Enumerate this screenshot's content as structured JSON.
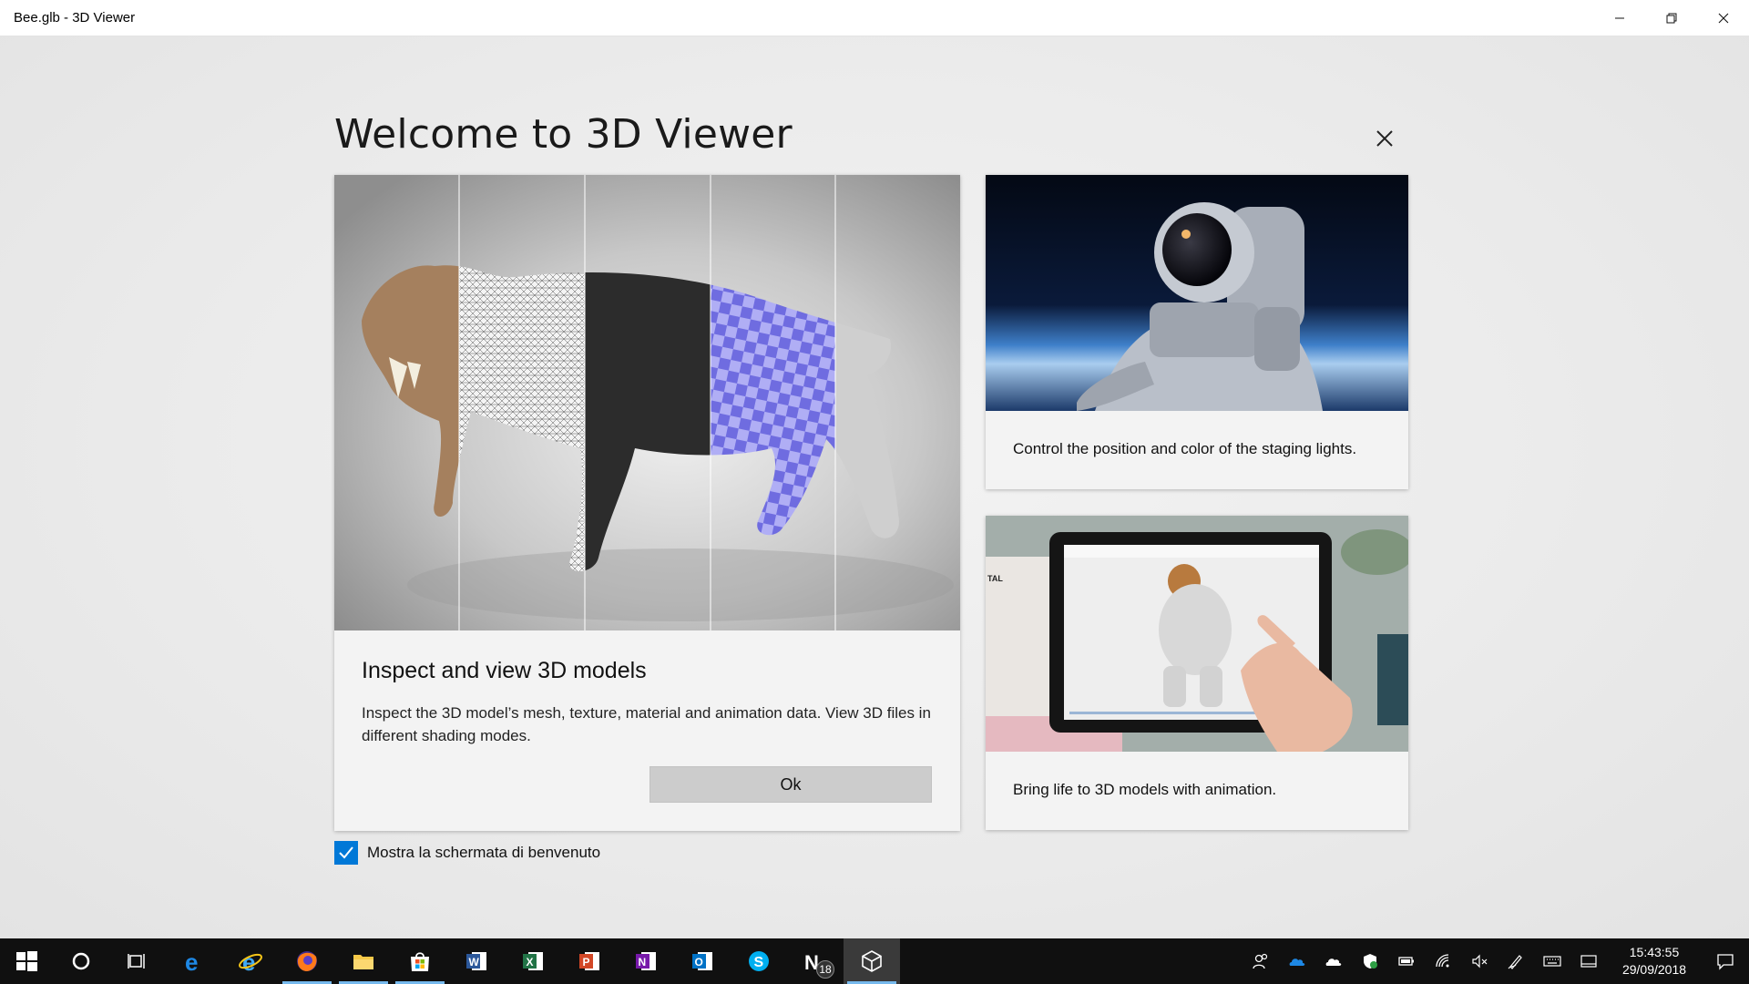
{
  "window": {
    "title": "Bee.glb - 3D Viewer",
    "controls": [
      "minimize",
      "restore",
      "close"
    ]
  },
  "welcome": {
    "title": "Welcome to 3D Viewer",
    "main_card": {
      "heading": "Inspect and view 3D models",
      "description": "Inspect the 3D model’s mesh, texture, material and animation data. View 3D files in different shading modes.",
      "ok_label": "Ok"
    },
    "side_cards": [
      {
        "caption": "Control the position and color of the staging lights."
      },
      {
        "caption": "Bring life to 3D models with animation."
      }
    ],
    "show_welcome": {
      "label": "Mostra la schermata di benvenuto",
      "checked": true
    }
  },
  "taskbar": {
    "apps": [
      {
        "icon": "start-icon"
      },
      {
        "icon": "cortana-icon"
      },
      {
        "icon": "task-view-icon"
      },
      {
        "icon": "edge-icon"
      },
      {
        "icon": "internet-explorer-icon"
      },
      {
        "icon": "firefox-icon",
        "running": true
      },
      {
        "icon": "file-explorer-icon",
        "running": true
      },
      {
        "icon": "store-icon",
        "running": true
      },
      {
        "icon": "word-icon"
      },
      {
        "icon": "excel-icon"
      },
      {
        "icon": "powerpoint-icon"
      },
      {
        "icon": "onenote-icon"
      },
      {
        "icon": "outlook-icon"
      },
      {
        "icon": "skype-icon"
      },
      {
        "icon": "nextcloud-icon",
        "badge": "18"
      },
      {
        "icon": "3d-viewer-icon",
        "active": true
      }
    ],
    "clock": {
      "time": "15:43:55",
      "date": "29/09/2018"
    }
  },
  "colors": {
    "accent": "#0078d7",
    "taskbar": "#101010"
  }
}
